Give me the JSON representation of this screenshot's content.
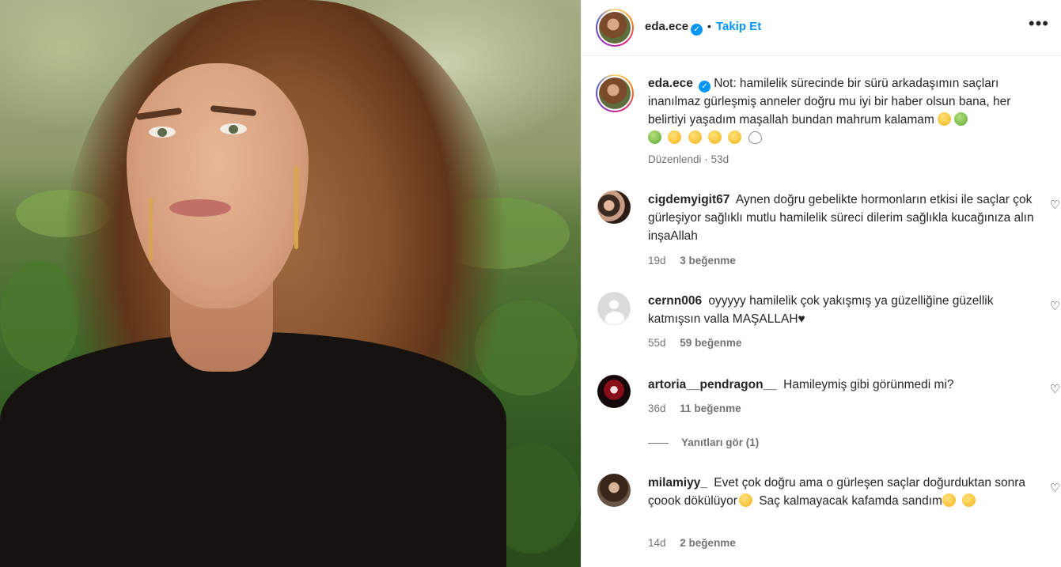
{
  "post": {
    "author": "eda.ece",
    "follow_label": "Takip Et",
    "separator": "•",
    "more_label": "•••",
    "caption": "Not: hamilelik sürecinde bir sürü arkadaşımın saçları inanılmaz gürleşmiş anneler doğru mu iyi bir haber olsun bana, her belirtiyi yaşadım maşallah bundan mahrum kalamam",
    "edited_label": "Düzenlendi",
    "edited_dot": "·",
    "age": "53d"
  },
  "comments": [
    {
      "username": "cigdemyigit67",
      "text": "Aynen doğru gebelikte hormonların etkisi ile saçlar çok gürleşiyor sağlıklı mutlu hamilelik süreci dilerim sağlıkla kucağınıza alın inşaAllah",
      "age": "19d",
      "likes": "3 beğenme"
    },
    {
      "username": "cernn006",
      "text": "oyyyyy hamilelik çok yakışmış ya güzelliğine güzellik katmışsın valla MAŞALLAH♥",
      "age": "55d",
      "likes": "59 beğenme"
    },
    {
      "username": "artoria__pendragon__",
      "text": "Hamileymiş gibi görünmedi mi?",
      "age": "36d",
      "likes": "11 beğenme"
    },
    {
      "username": "milamiyy_",
      "text": "Evet çok doğru ama o gürleşen saçlar doğurduktan sonra çoook dökülüyor",
      "text2": "Saç kalmayacak kafamda sandım",
      "age": "14d",
      "likes": "2 beğenme"
    }
  ],
  "view_replies_label": "Yanıtları gör (1)",
  "verified_mark": "✓",
  "heart_glyph": "♡",
  "colors": {
    "accent": "#0095f6",
    "text_primary": "#262626",
    "text_secondary": "#737373",
    "divider": "#efefef"
  }
}
